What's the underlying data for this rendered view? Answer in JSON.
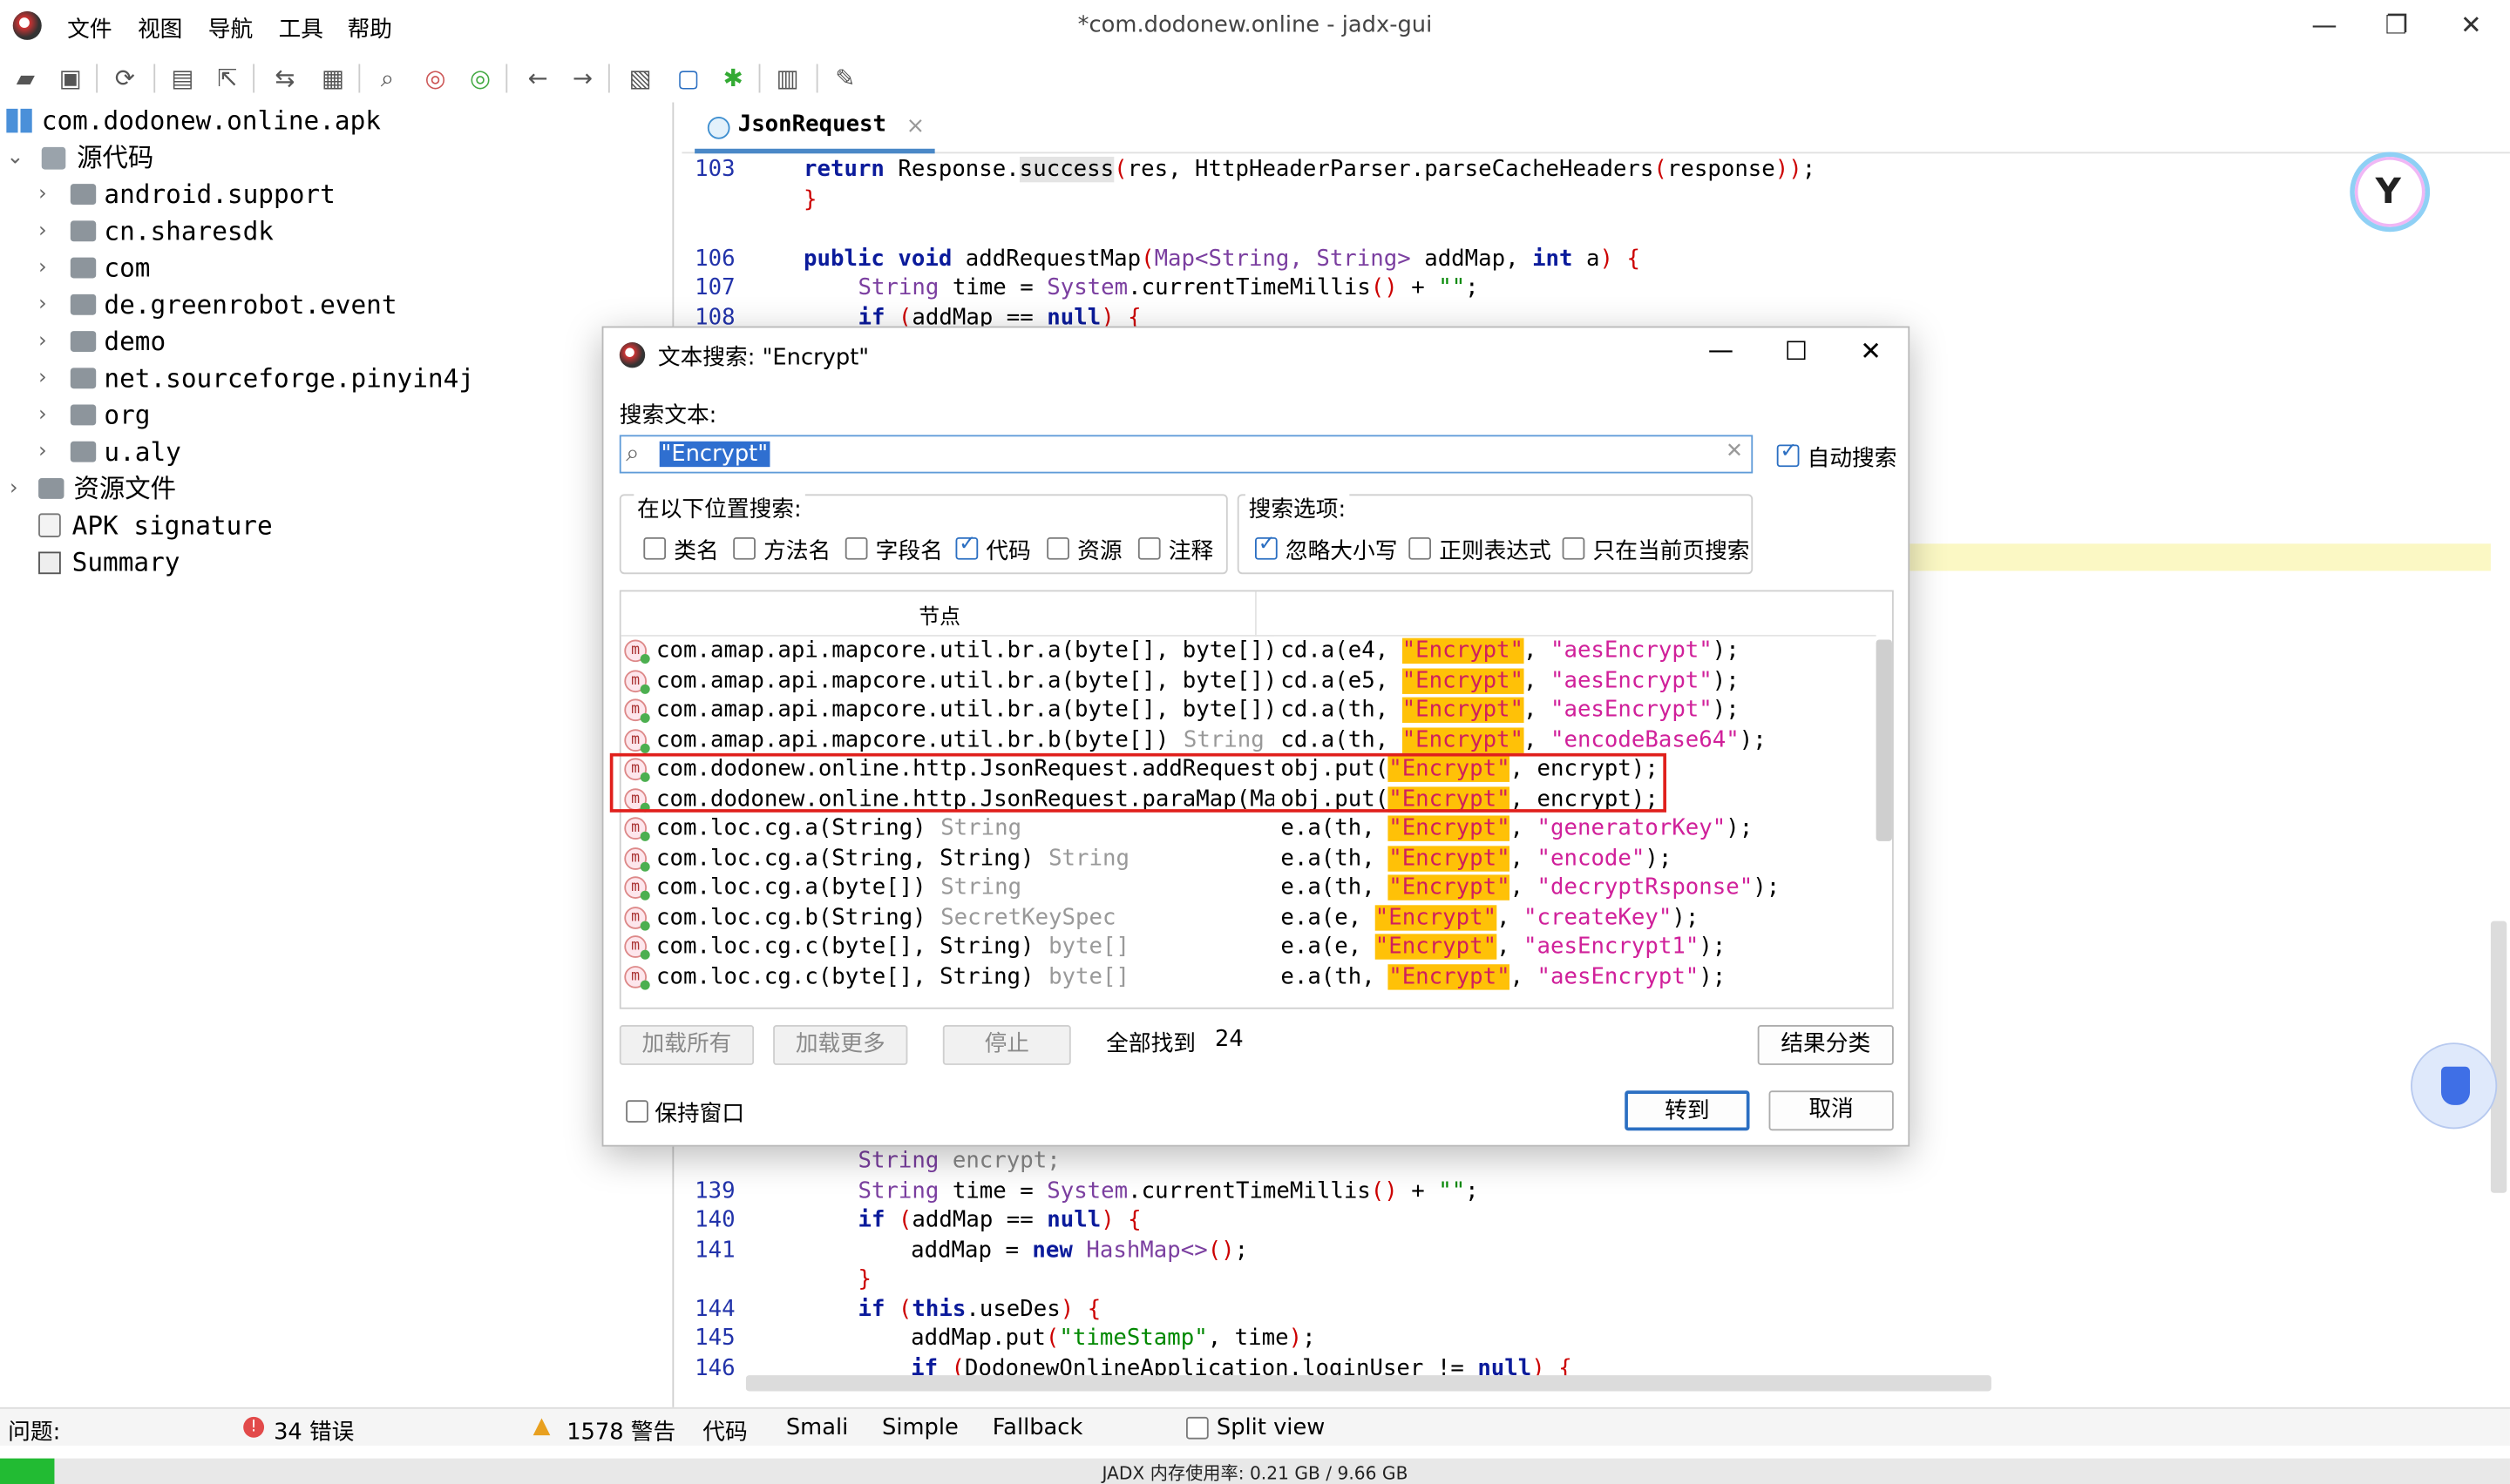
{
  "app": {
    "window_title": "*com.dodonew.online - jadx-gui",
    "menu": [
      "文件",
      "视图",
      "导航",
      "工具",
      "帮助"
    ]
  },
  "toolbar_icons": [
    "open-file-icon",
    "add-files-icon",
    "reload-icon",
    "save-icon",
    "export-icon",
    "sync-icon",
    "open-folder-icon",
    "search-icon",
    "search-class-icon",
    "search-usage-icon",
    "back-icon",
    "forward-icon",
    "decompile-icon",
    "deobfuscate-icon",
    "debug-icon",
    "log-icon",
    "settings-icon"
  ],
  "tree": {
    "root": "com.dodonew.online.apk",
    "source_label": "源代码",
    "packages": [
      "android.support",
      "cn.sharesdk",
      "com",
      "de.greenrobot.event",
      "demo",
      "net.sourceforge.pinyin4j",
      "org",
      "u.aly"
    ],
    "resources_label": "资源文件",
    "apk_signature": "APK signature",
    "summary": "Summary"
  },
  "editor": {
    "tab_label": "JsonRequest",
    "tab_close": "×",
    "code_top": [
      {
        "ln": "103",
        "text": "        return Response.success(res, HttpHeaderParser.parseCacheHeaders(response));"
      },
      {
        "ln": "",
        "text": "    }"
      },
      {
        "ln": "",
        "text": ""
      },
      {
        "ln": "106",
        "text": "    public void addRequestMap(Map<String, String> addMap, int a) {"
      },
      {
        "ln": "107",
        "text": "        String time = System.currentTimeMillis() + \"\";"
      },
      {
        "ln": "108",
        "text": "        if (addMap == null) {"
      }
    ],
    "code_bottom": [
      {
        "ln": "",
        "text": "        String encrypt;"
      },
      {
        "ln": "139",
        "text": "        String time = System.currentTimeMillis() + \"\";"
      },
      {
        "ln": "140",
        "text": "        if (addMap == null) {"
      },
      {
        "ln": "141",
        "text": "            addMap = new HashMap<>();"
      },
      {
        "ln": "",
        "text": "        }"
      },
      {
        "ln": "144",
        "text": "        if (this.useDes) {"
      },
      {
        "ln": "145",
        "text": "            addMap.put(\"timeStamp\", time);"
      },
      {
        "ln": "146",
        "text": "            if (DodonewOnlineApplication.loginUser != null) {"
      }
    ]
  },
  "dialog": {
    "title": "文本搜索: \"Encrypt\"",
    "search_label": "搜索文本:",
    "search_value": "\"Encrypt\"",
    "auto_search": "自动搜索",
    "scope_title": "在以下位置搜索:",
    "scope": [
      {
        "label": "类名",
        "checked": false
      },
      {
        "label": "方法名",
        "checked": false
      },
      {
        "label": "字段名",
        "checked": false
      },
      {
        "label": "代码",
        "checked": true
      },
      {
        "label": "资源",
        "checked": false
      },
      {
        "label": "注释",
        "checked": false
      }
    ],
    "options_title": "搜索选项:",
    "options": [
      {
        "label": "忽略大小写",
        "checked": true
      },
      {
        "label": "正则表达式",
        "checked": false
      },
      {
        "label": "只在当前页搜索",
        "checked": false
      }
    ],
    "column_node": "节点",
    "results": [
      {
        "node": "com.amap.api.mapcore.util.br.a(byte[], byte[])",
        "ret": "",
        "pre": "cd.a(e4, ",
        "hit": "\"Encrypt\"",
        "post": ", ",
        "arg": "\"aesEncrypt\"",
        "end": ");"
      },
      {
        "node": "com.amap.api.mapcore.util.br.a(byte[], byte[])",
        "ret": "",
        "pre": "cd.a(e5, ",
        "hit": "\"Encrypt\"",
        "post": ", ",
        "arg": "\"aesEncrypt\"",
        "end": ");"
      },
      {
        "node": "com.amap.api.mapcore.util.br.a(byte[], byte[])",
        "ret": "",
        "pre": "cd.a(th, ",
        "hit": "\"Encrypt\"",
        "post": ", ",
        "arg": "\"aesEncrypt\"",
        "end": ");"
      },
      {
        "node": "com.amap.api.mapcore.util.br.b(byte[])",
        "ret": "String",
        "pre": "cd.a(th, ",
        "hit": "\"Encrypt\"",
        "post": ", ",
        "arg": "\"encodeBase64\"",
        "end": ");"
      },
      {
        "node": "com.dodonew.online.http.JsonRequest.addRequest",
        "ret": "",
        "pre": "obj.put(",
        "hit": "\"Encrypt\"",
        "post": ", encrypt",
        "arg": "",
        "end": ");"
      },
      {
        "node": "com.dodonew.online.http.JsonRequest.paraMap(Ma",
        "ret": "",
        "pre": "obj.put(",
        "hit": "\"Encrypt\"",
        "post": ", encrypt",
        "arg": "",
        "end": ");"
      },
      {
        "node": "com.loc.cg.a(String)",
        "ret": "String",
        "pre": "e.a(th, ",
        "hit": "\"Encrypt\"",
        "post": ", ",
        "arg": "\"generatorKey\"",
        "end": ");"
      },
      {
        "node": "com.loc.cg.a(String, String)",
        "ret": "String",
        "pre": "e.a(th, ",
        "hit": "\"Encrypt\"",
        "post": ", ",
        "arg": "\"encode\"",
        "end": ");"
      },
      {
        "node": "com.loc.cg.a(byte[])",
        "ret": "String",
        "pre": "e.a(th, ",
        "hit": "\"Encrypt\"",
        "post": ", ",
        "arg": "\"decryptRsponse\"",
        "end": ");"
      },
      {
        "node": "com.loc.cg.b(String)",
        "ret": "SecretKeySpec",
        "pre": "e.a(e, ",
        "hit": "\"Encrypt\"",
        "post": ", ",
        "arg": "\"createKey\"",
        "end": ");"
      },
      {
        "node": "com.loc.cg.c(byte[], String)",
        "ret": "byte[]",
        "pre": "e.a(e, ",
        "hit": "\"Encrypt\"",
        "post": ", ",
        "arg": "\"aesEncrypt1\"",
        "end": ");"
      },
      {
        "node": "com.loc.cg.c(byte[], String)",
        "ret": "byte[]",
        "pre": "e.a(th, ",
        "hit": "\"Encrypt\"",
        "post": ", ",
        "arg": "\"aesEncrypt\"",
        "end": ");"
      }
    ],
    "btn_load_all": "加载所有",
    "btn_load_more": "加载更多",
    "btn_stop": "停止",
    "found_label": "全部找到",
    "found_count": "24",
    "btn_group": "结果分类",
    "keep_open": "保持窗口",
    "btn_goto": "转到",
    "btn_cancel": "取消"
  },
  "status": {
    "problems": "问题:",
    "errors": "34 错误",
    "warnings": "1578 警告",
    "tabs": [
      "代码",
      "Smali",
      "Simple",
      "Fallback"
    ],
    "split_view": "Split view",
    "memory": "JADX 内存使用率:  0.21 GB / 9.66 GB",
    "memory_fraction": 0.022
  },
  "colors": {
    "highlight_hit": "#ffc107",
    "selection_box": "#e0201c",
    "accent_blue": "#2b6fc2",
    "memory_green": "#22bb33"
  }
}
